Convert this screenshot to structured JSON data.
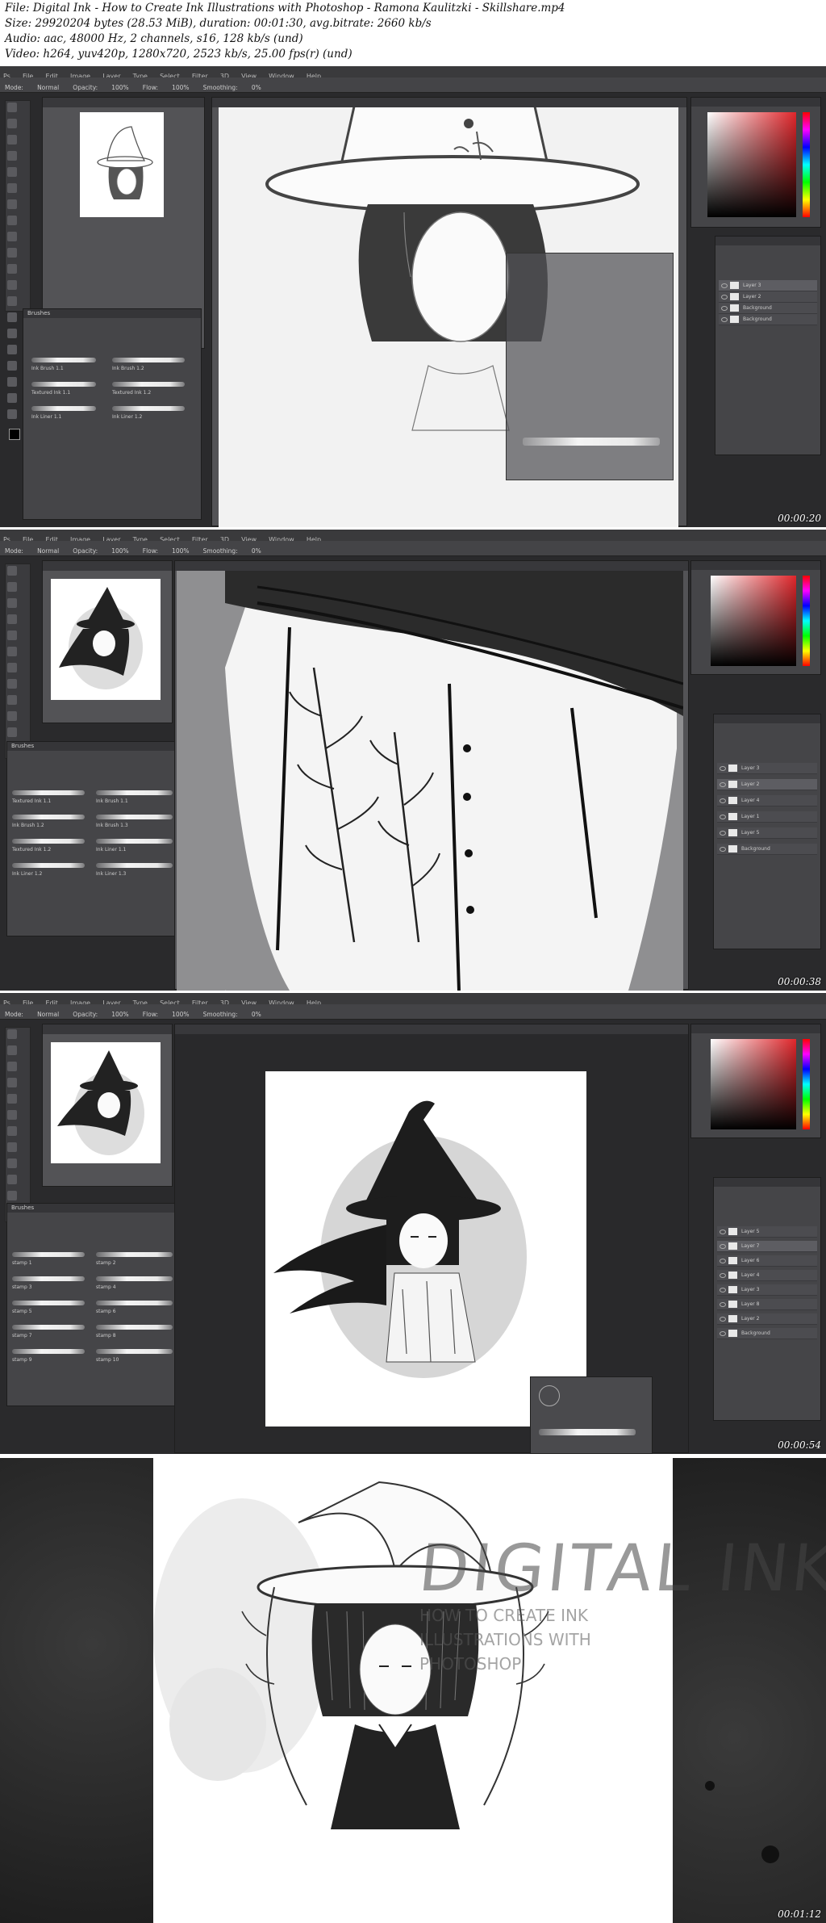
{
  "header": {
    "file_line": "File: Digital Ink - How to Create Ink Illustrations with Photoshop - Ramona Kaulitzki - Skillshare.mp4",
    "size_line": "Size: 29920204 bytes (28.53 MiB), duration: 00:01:30, avg.bitrate: 2660 kb/s",
    "audio_line": "Audio: aac, 48000 Hz, 2 channels, s16, 128 kb/s (und)",
    "video_line": "Video: h264, yuv420p, 1280x720, 2523 kb/s, 25.00 fps(r) (und)"
  },
  "frames": [
    {
      "timestamp": "00:00:20",
      "menu": [
        "Ps",
        "File",
        "Edit",
        "Image",
        "Layer",
        "Type",
        "Select",
        "Filter",
        "3D",
        "View",
        "Window",
        "Help"
      ],
      "options": [
        "Mode:",
        "Normal",
        "Opacity:",
        "100%",
        "Flow:",
        "100%",
        "Smoothing:",
        "0%"
      ],
      "nav_tab": "",
      "doc_tab": "",
      "brush_panel_title": "Brushes",
      "brushes": [
        "Ink Brush 1.1",
        "Ink Brush 1.2",
        "Textured Ink 1.1",
        "Textured Ink 1.2",
        "Ink Liner 1.1",
        "Ink Liner 1.2"
      ],
      "layers": [
        "Layer 3",
        "Layer 2",
        "Background",
        "Background"
      ],
      "colors": {
        "fg": "#000000",
        "bg": "#ffffff"
      }
    },
    {
      "timestamp": "00:00:38",
      "menu": [
        "Ps",
        "File",
        "Edit",
        "Image",
        "Layer",
        "Type",
        "Select",
        "Filter",
        "3D",
        "View",
        "Window",
        "Help"
      ],
      "options": [
        "Mode:",
        "Normal",
        "Opacity:",
        "100%",
        "Flow:",
        "100%",
        "Smoothing:",
        "0%"
      ],
      "nav_tab": "",
      "doc_tab": "",
      "brush_panel_title": "Brushes",
      "brushes": [
        "Textured Ink 1.1",
        "Ink Brush 1.1",
        "Ink Brush 1.2",
        "Ink Brush 1.3",
        "Textured Ink 1.2",
        "Ink Liner 1.1",
        "Ink Liner 1.2",
        "Ink Liner 1.3"
      ],
      "layers": [
        "Layer 3",
        "Layer 2",
        "Layer 4",
        "Layer 1",
        "Layer 5",
        "Background"
      ],
      "colors": {
        "fg": "#111111",
        "bg": "#ffffff"
      }
    },
    {
      "timestamp": "00:00:54",
      "menu": [
        "Ps",
        "File",
        "Edit",
        "Image",
        "Layer",
        "Type",
        "Select",
        "Filter",
        "3D",
        "View",
        "Window",
        "Help"
      ],
      "options": [
        "Mode:",
        "Normal",
        "Opacity:",
        "100%",
        "Flow:",
        "100%",
        "Smoothing:",
        "0%"
      ],
      "nav_tab": "",
      "doc_tab": "",
      "brush_panel_title": "Brushes",
      "brushes": [
        "stamp 1",
        "stamp 2",
        "stamp 3",
        "stamp 4",
        "stamp 5",
        "stamp 6",
        "stamp 7",
        "stamp 8",
        "stamp 9",
        "stamp 10"
      ],
      "layers": [
        "Layer 5",
        "Layer 7",
        "Layer 6",
        "Layer 4",
        "Layer 3",
        "Layer 8",
        "Layer 2",
        "Background"
      ],
      "colors": {
        "fg": "#ffffff",
        "bg": "#000000"
      }
    },
    {
      "timestamp": "00:01:12",
      "title_art": "DIGITAL INK",
      "subtitle_art": "HOW TO CREATE INK ILLUSTRATIONS WITH PHOTOSHOP"
    }
  ]
}
